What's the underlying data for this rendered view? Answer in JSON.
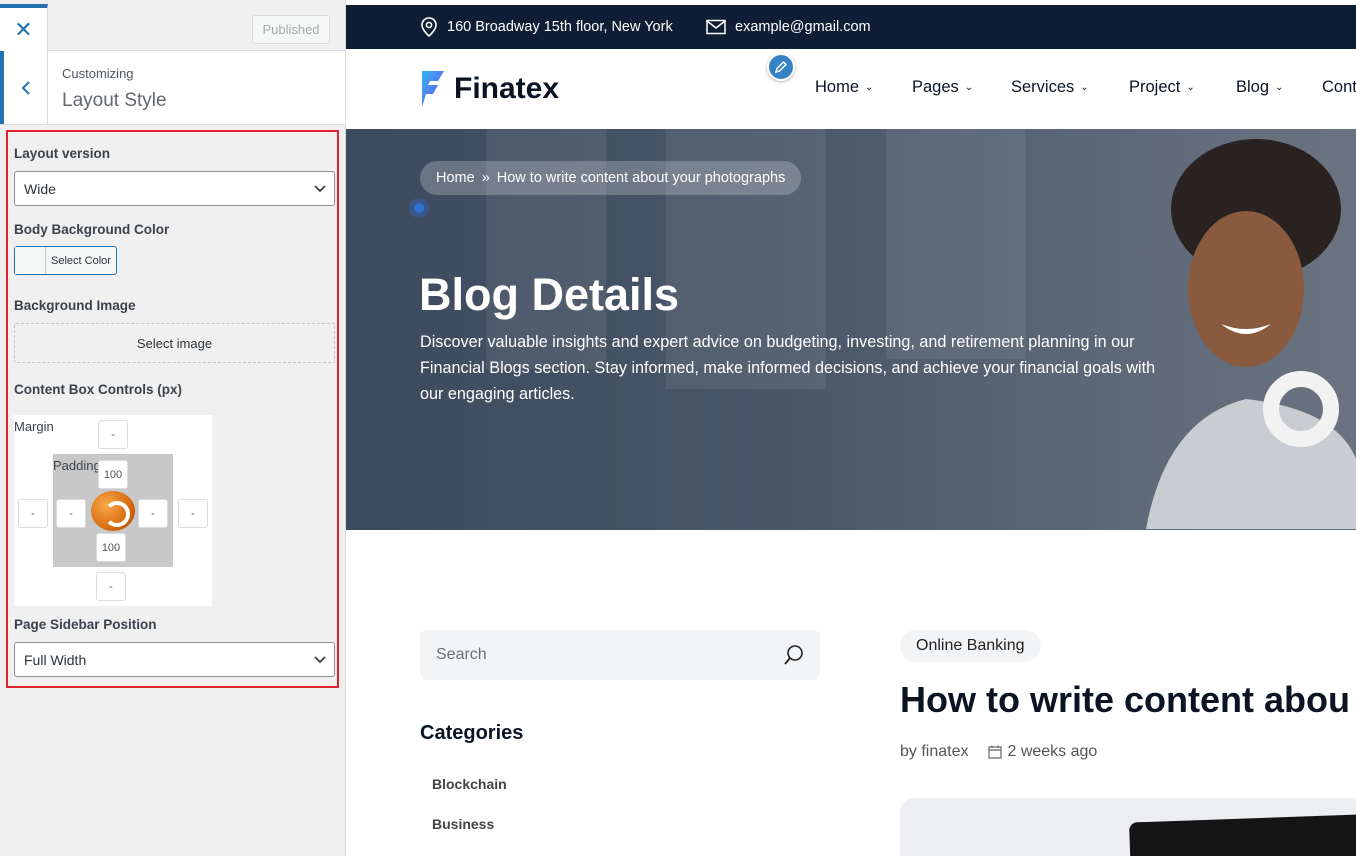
{
  "customizer": {
    "close_icon": "close-icon",
    "published_label": "Published",
    "customizing_label": "Customizing",
    "section_title": "Layout Style",
    "layout_version": {
      "label": "Layout version",
      "value": "Wide"
    },
    "body_bg": {
      "label": "Body Background Color",
      "button": "Select Color"
    },
    "bg_image": {
      "label": "Background Image",
      "button": "Select image"
    },
    "box_controls": {
      "label": "Content Box Controls (px)",
      "margin_label": "Margin",
      "padding_label": "Padding",
      "margin_top": "-",
      "margin_left": "-",
      "margin_right": "-",
      "margin_bottom": "-",
      "padding_top": "100",
      "padding_left": "-",
      "padding_right": "-",
      "padding_bottom": "100"
    },
    "sidebar_position": {
      "label": "Page Sidebar Position",
      "value": "Full Width"
    },
    "accent_color": "#2271b1",
    "highlight_color": "#e0202a"
  },
  "site": {
    "topbar": {
      "address": "160 Broadway 15th floor, New York",
      "email": "example@gmail.com",
      "bg_color": "#0f1d35"
    },
    "brand": "Finatex",
    "nav": [
      "Home",
      "Pages",
      "Services",
      "Project",
      "Blog",
      "Cont"
    ],
    "breadcrumb": {
      "home": "Home",
      "separator": "»",
      "current": "How to write content about your photographs"
    },
    "hero": {
      "title": "Blog Details",
      "description": "Discover valuable insights and expert advice on budgeting, investing, and retirement planning in our Financial Blogs section. Stay informed, make informed decisions, and achieve your financial goals with our engaging articles."
    },
    "search_placeholder": "Search",
    "categories_title": "Categories",
    "categories": [
      "Blockchain",
      "Business"
    ],
    "post": {
      "tag": "Online Banking",
      "title": "How to write content abou",
      "author": "by finatex",
      "date": "2 weeks ago"
    }
  }
}
